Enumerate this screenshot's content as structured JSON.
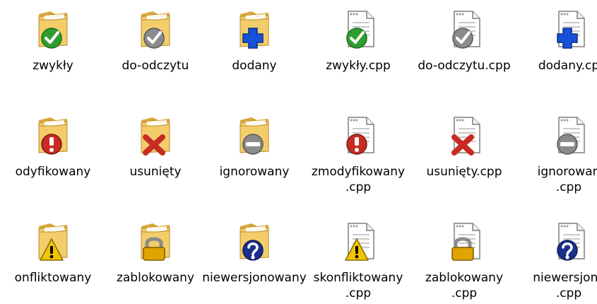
{
  "icons": [
    {
      "row": 0,
      "col": 0,
      "type": "folder",
      "overlay": "check-green",
      "label1": "zwykły",
      "label2": ""
    },
    {
      "row": 0,
      "col": 1,
      "type": "folder",
      "overlay": "check-gray",
      "label1": "do-odczytu",
      "label2": ""
    },
    {
      "row": 0,
      "col": 2,
      "type": "folder",
      "overlay": "plus-blue",
      "label1": "dodany",
      "label2": ""
    },
    {
      "row": 0,
      "col": 3,
      "type": "file",
      "overlay": "check-green",
      "label1": "zwykły.cpp",
      "label2": ""
    },
    {
      "row": 0,
      "col": 4,
      "type": "file",
      "overlay": "check-gray",
      "label1": "do-odczytu.cpp",
      "label2": ""
    },
    {
      "row": 0,
      "col": 5,
      "type": "file",
      "overlay": "plus-blue",
      "label1": "dodany.cp",
      "label2": ""
    },
    {
      "row": 1,
      "col": 0,
      "type": "folder",
      "overlay": "exclaim-red",
      "label1": "odyfikowany",
      "label2": ""
    },
    {
      "row": 1,
      "col": 1,
      "type": "folder",
      "overlay": "x-red",
      "label1": "usunięty",
      "label2": ""
    },
    {
      "row": 1,
      "col": 2,
      "type": "folder",
      "overlay": "minus-gray",
      "label1": "ignorowany",
      "label2": ""
    },
    {
      "row": 1,
      "col": 3,
      "type": "file",
      "overlay": "exclaim-red",
      "label1": "zmodyfikowany",
      "label2": ".cpp"
    },
    {
      "row": 1,
      "col": 4,
      "type": "file",
      "overlay": "x-red",
      "label1": "usunięty.cpp",
      "label2": ""
    },
    {
      "row": 1,
      "col": 5,
      "type": "file",
      "overlay": "minus-gray",
      "label1": "ignorowan",
      "label2": ".cpp"
    },
    {
      "row": 2,
      "col": 0,
      "type": "folder",
      "overlay": "warn-yellow",
      "label1": "onfliktowany",
      "label2": ""
    },
    {
      "row": 2,
      "col": 1,
      "type": "folder",
      "overlay": "lock",
      "label1": "zablokowany",
      "label2": ""
    },
    {
      "row": 2,
      "col": 2,
      "type": "folder",
      "overlay": "question-blue",
      "label1": "niewersjonowany",
      "label2": ""
    },
    {
      "row": 2,
      "col": 3,
      "type": "file",
      "overlay": "warn-yellow",
      "label1": "skonfliktowany",
      "label2": ".cpp"
    },
    {
      "row": 2,
      "col": 4,
      "type": "file",
      "overlay": "lock",
      "label1": "zablokowany",
      "label2": ".cpp"
    },
    {
      "row": 2,
      "col": 5,
      "type": "file",
      "overlay": "question-blue",
      "label1": "niewersjonc",
      "label2": ".cpp"
    }
  ],
  "colors": {
    "folder_body": "#f2cd69",
    "folder_dark": "#d7a93a",
    "paper": "#ffffff",
    "paper_line": "#c9c9c9",
    "green": "#2f9e2f",
    "gray": "#8b8b8b",
    "blue": "#1651d8",
    "red": "#c72b23",
    "yellow": "#f2c500"
  }
}
